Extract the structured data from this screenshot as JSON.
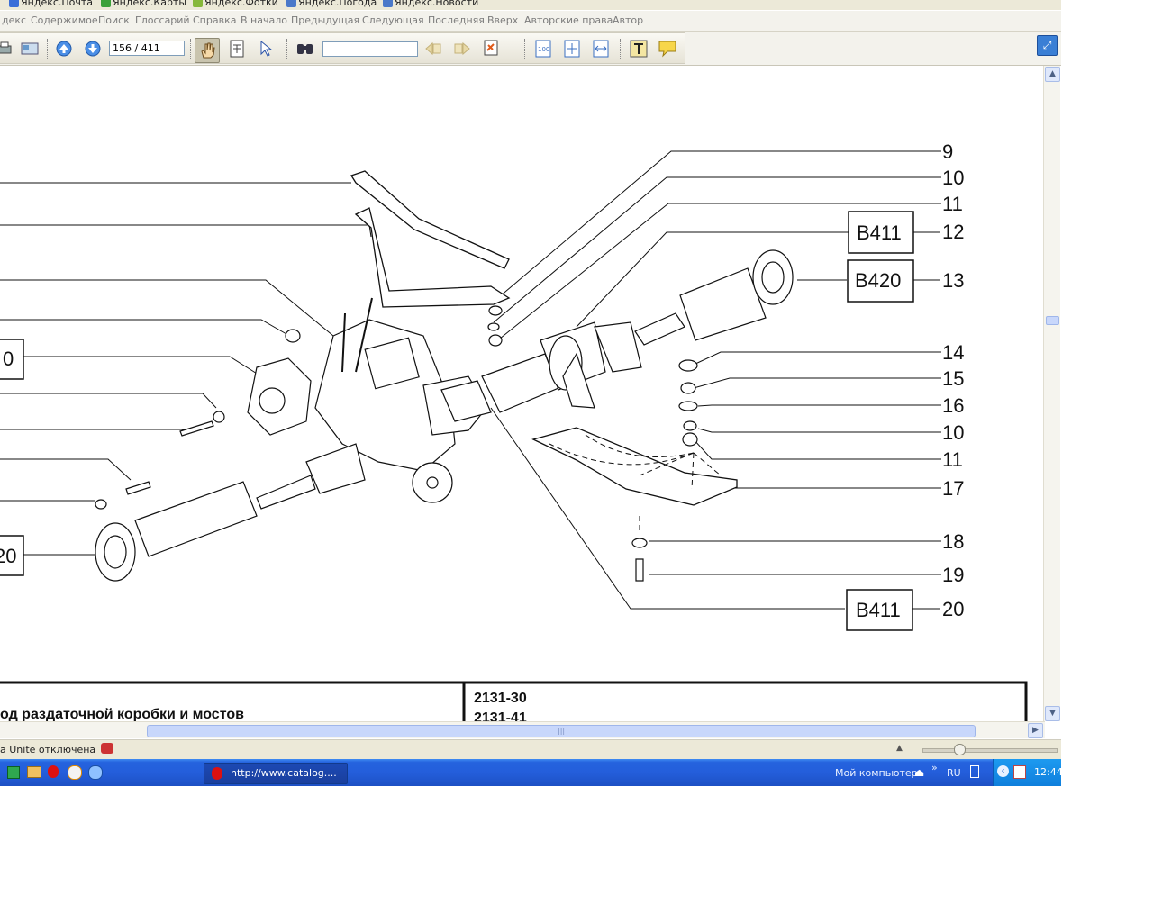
{
  "bookmarks": [
    {
      "label": "Яндекс.Почта",
      "color": "#3b6fd8"
    },
    {
      "label": "Яндекс.Карты",
      "color": "#3aa13a"
    },
    {
      "label": "Яндекс.Фотки",
      "color": "#86b83a"
    },
    {
      "label": "Яндекс.Погода",
      "color": "#4b79c9"
    },
    {
      "label": "Яндекс.Новости",
      "color": "#4b79c9"
    }
  ],
  "menu": [
    "декс",
    "Содержимое",
    "Поиск",
    "Глоссарий",
    "Справка",
    "В начало",
    "Предыдущая",
    "Следующая",
    "Последняя",
    "Вверх",
    "Авторские права",
    "Автор"
  ],
  "toolbar": {
    "page_value": "156 / 411",
    "find_value": "",
    "icons": [
      "print-icon",
      "view-icon",
      "prev-page-icon",
      "next-page-icon",
      "hand-tool-icon",
      "text-select-icon",
      "pointer-icon",
      "find-icon",
      "find-prev-icon",
      "find-next-icon",
      "find-options-icon",
      "zoom-100-icon",
      "fit-page-icon",
      "fit-width-icon",
      "text-tool-icon",
      "annotation-icon",
      "expand-icon"
    ]
  },
  "diagram": {
    "callouts_right": [
      "9",
      "10",
      "11",
      "12",
      "13",
      "14",
      "15",
      "16",
      "10",
      "11",
      "17",
      "18",
      "19",
      "20"
    ],
    "boxed_refs": {
      "r12": "B411",
      "r13": "B420",
      "r20": "B411"
    },
    "left_partial_boxes": [
      "0",
      "20"
    ],
    "title_block": {
      "left_text": "од раздаточной коробки и мостов",
      "codes": [
        "2131-30",
        "2131-41"
      ]
    }
  },
  "status": {
    "text": "a Unite отключена"
  },
  "taskbar": {
    "task_label": "http://www.catalog....",
    "my_computer": "Мой компьютер",
    "lang": "RU",
    "clock": "12:44"
  },
  "colors": {
    "taskbar": "#245edb",
    "tray": "#0f7fdc",
    "menu_text": "#7c7c7c"
  }
}
